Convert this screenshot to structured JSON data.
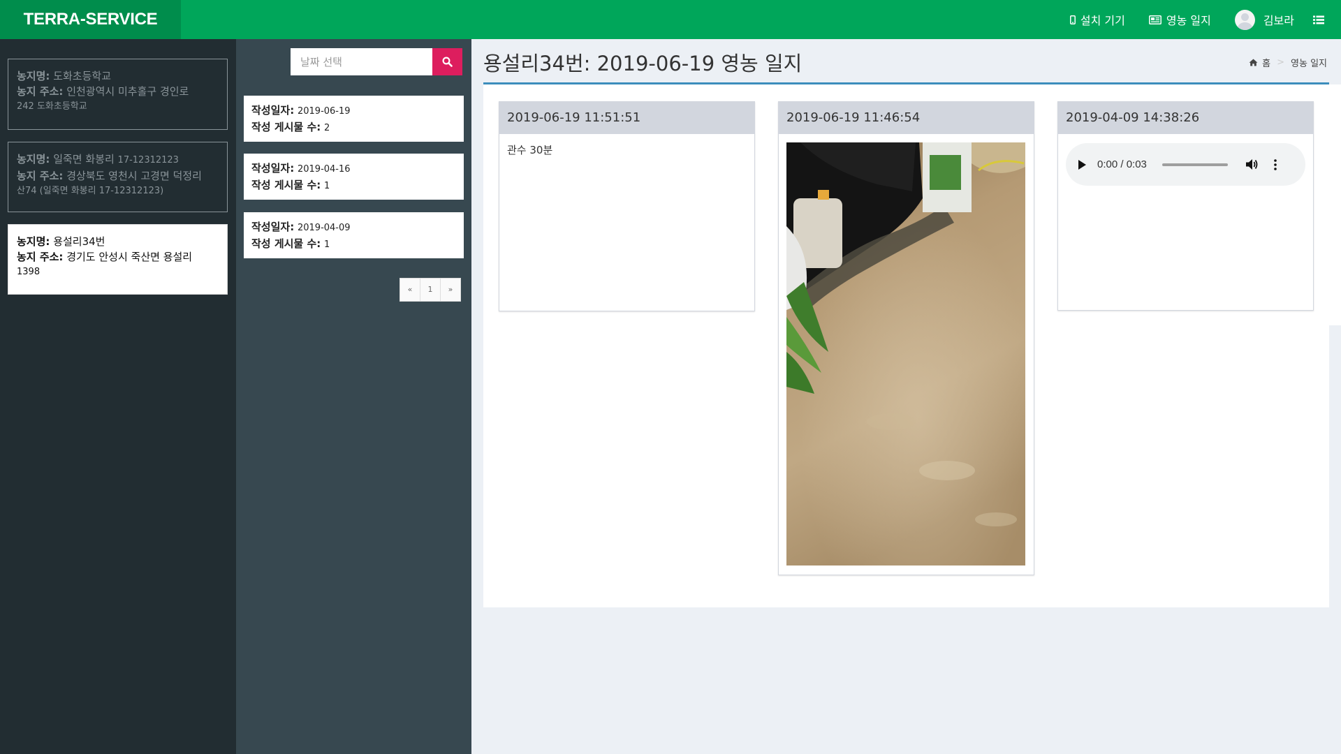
{
  "navbar": {
    "logo": "TERRA-SERVICE",
    "devices_label": "설치 기기",
    "journal_label": "영농 일지",
    "user_name": "김보라"
  },
  "farms": [
    {
      "name_label": "농지명:",
      "name": "도화초등학교",
      "addr_label": "농지 주소:",
      "addr": "인천광역시 미추홀구 경인로",
      "addr2": "242 도화초등학교"
    },
    {
      "name_label": "농지명:",
      "name": "일죽면 화봉리",
      "name_suffix": "17-12312123",
      "addr_label": "농지 주소:",
      "addr": "경상북도 영천시 고경면 덕정리",
      "addr2": "산74 (일죽면 화봉리 17-12312123)"
    },
    {
      "name_label": "농지명:",
      "name": "용설리34번",
      "addr_label": "농지 주소:",
      "addr": "경기도 안성시 죽산면 용설리",
      "addr2": "1398"
    }
  ],
  "search": {
    "placeholder": "날짜 선택"
  },
  "dates": [
    {
      "date_label": "작성일자:",
      "date": "2019-06-19",
      "count_label": "작성 게시물 수:",
      "count": "2"
    },
    {
      "date_label": "작성일자:",
      "date": "2019-04-16",
      "count_label": "작성 게시물 수:",
      "count": "1"
    },
    {
      "date_label": "작성일자:",
      "date": "2019-04-09",
      "count_label": "작성 게시물 수:",
      "count": "1"
    }
  ],
  "pagination": {
    "prev": "«",
    "page": "1",
    "next": "»"
  },
  "content": {
    "title": "용설리34번: 2019-06-19 영농 일지",
    "breadcrumb_home": "홈",
    "breadcrumb_current": "영농 일지"
  },
  "posts": [
    {
      "timestamp": "2019-06-19 11:51:51",
      "text": "관수 30분"
    },
    {
      "timestamp": "2019-06-19 11:46:54"
    },
    {
      "timestamp": "2019-04-09 14:38:26",
      "audio_time": "0:00 / 0:03"
    }
  ],
  "colors": {
    "navbar": "#00a65a",
    "logo_bg": "#008d4c",
    "sidebar_dark": "#222d32",
    "sidebar_mid": "#374850",
    "search_btn": "#dd1e5e",
    "box_border": "#3c8dbc"
  }
}
